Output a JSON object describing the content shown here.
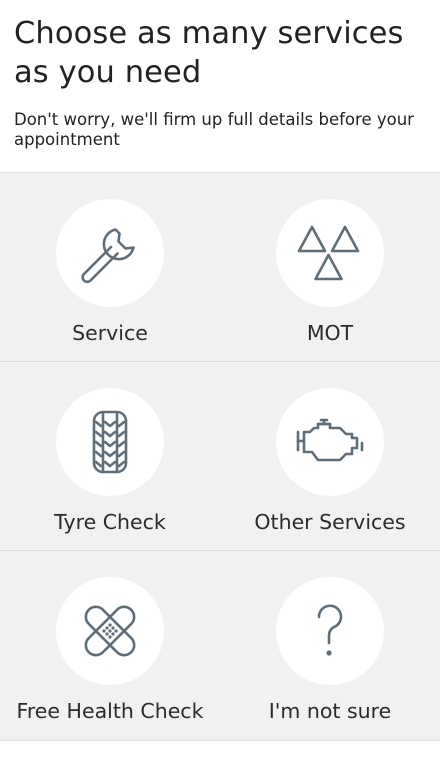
{
  "header": {
    "title": "Choose as many services as you need",
    "subtitle": "Don't worry, we'll firm up full details before your appointment"
  },
  "services": [
    {
      "label": "Service",
      "icon": "wrench-icon"
    },
    {
      "label": "MOT",
      "icon": "warning-triangles-icon"
    },
    {
      "label": "Tyre Check",
      "icon": "tyre-icon"
    },
    {
      "label": "Other Services",
      "icon": "engine-icon"
    },
    {
      "label": "Free Health Check",
      "icon": "bandage-icon"
    },
    {
      "label": "I'm not sure",
      "icon": "question-mark-icon"
    }
  ],
  "colors": {
    "icon": "#5f6e77",
    "background": "#f1f1f1",
    "circle": "#ffffff"
  }
}
